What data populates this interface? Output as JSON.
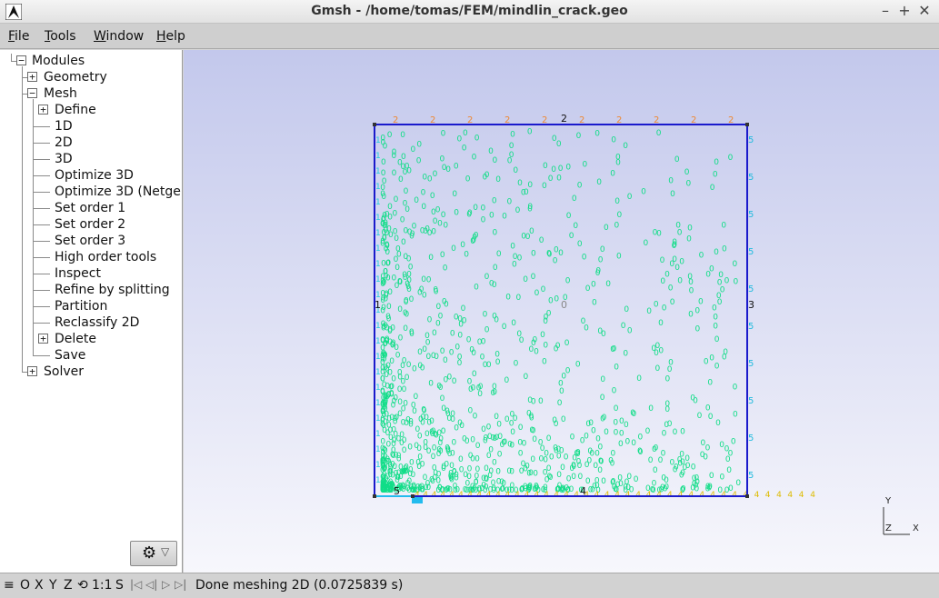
{
  "window": {
    "title": "Gmsh - /home/tomas/FEM/mindlin_crack.geo",
    "minimize": "–",
    "maximize": "+",
    "close": "✕"
  },
  "menu": {
    "file": {
      "ul": "F",
      "rest": "ile"
    },
    "tools": {
      "ul": "T",
      "rest": "ools"
    },
    "window": {
      "ul": "W",
      "rest": "indow"
    },
    "help": {
      "ul": "H",
      "rest": "elp"
    }
  },
  "tree": {
    "modules": "Modules",
    "geometry": "Geometry",
    "mesh": "Mesh",
    "define": "Define",
    "one_d": "1D",
    "two_d": "2D",
    "three_d": "3D",
    "optimize3d": "Optimize 3D",
    "optimize3d_netgen": "Optimize 3D (Netgen)",
    "set_order_1": "Set order 1",
    "set_order_2": "Set order 2",
    "set_order_3": "Set order 3",
    "high_order_tools": "High order tools",
    "inspect": "Inspect",
    "refine_by_splitting": "Refine by splitting",
    "partition": "Partition",
    "reclassify_2d": "Reclassify 2D",
    "delete": "Delete",
    "save": "Save",
    "solver": "Solver",
    "expand_symbol": "+",
    "collapse_symbol": "−"
  },
  "gear_button": {
    "icon": "⚙",
    "arrow": "▽"
  },
  "viewport": {
    "curve_labels": {
      "bottom": "4",
      "right": "3",
      "top": "2",
      "left": "1",
      "crack": "5"
    },
    "curve_label_tags": {
      "top": "2",
      "left": "1",
      "right": "3",
      "bottom": "4",
      "corner": "5"
    },
    "surface_label": "0",
    "node_label": "0",
    "side_node_label_left": "1",
    "side_node_label_right": "3",
    "triad": {
      "y": "Y",
      "z": "Z",
      "x": "X"
    },
    "colors": {
      "boundary": "#1a1acc",
      "nodes": "#11dd88",
      "top_nodes": "#ee8833",
      "bottom_nodes": "#ddbb00",
      "right_nodes": "#22bbdd",
      "left_nodes": "#22ccdd",
      "crack_fill": "#22bbee"
    }
  },
  "status": {
    "menu_icon": "≡",
    "o": "O",
    "x": "X",
    "y": "Y",
    "z": "Z",
    "rotate_icon": "⟲",
    "scale": "1:1",
    "s": "S",
    "nav_first": "|◁",
    "nav_prev": "◁|",
    "nav_next": "▷",
    "nav_last": "▷|",
    "message": "Done meshing 2D (0.0725839 s)"
  }
}
